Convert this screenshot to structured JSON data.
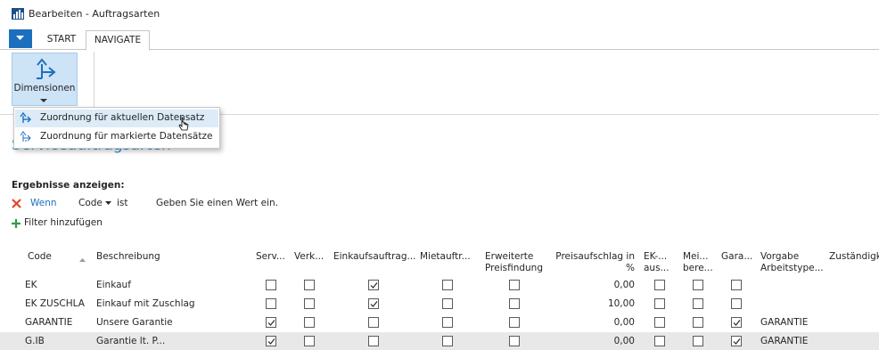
{
  "window": {
    "title": "Bearbeiten - Auftragsarten"
  },
  "ribbon": {
    "tabs": [
      {
        "label": "START"
      },
      {
        "label": "NAVIGATE"
      }
    ],
    "dimensionen_label": "Dimensionen",
    "menu": [
      {
        "label": "Zuordnung für aktuellen Datensatz"
      },
      {
        "label": "Zuordnung für markierte Datensätze"
      }
    ]
  },
  "page": {
    "title": "Serviceauftragsarten"
  },
  "filter": {
    "header": "Ergebnisse anzeigen:",
    "wenn": "Wenn",
    "field": "Code",
    "op": "ist",
    "value_placeholder": "Geben Sie einen Wert ein.",
    "add_label": "Filter hinzufügen"
  },
  "table": {
    "headers": {
      "code": "Code",
      "beschreibung": "Beschreibung",
      "serv": "Serv...",
      "verk": "Verk...",
      "einkauf": "Einkaufsauftrag...",
      "miet": "Mietauftr...",
      "erw1": "Erweiterte",
      "erw2": "Preisfindung",
      "preis1": "Preisaufschlag in",
      "preis2": "%",
      "ek1": "EK-...",
      "ek2": "aus...",
      "mei1": "Mei...",
      "mei2": "bere...",
      "gara": "Gara...",
      "vorgabe1": "Vorgabe",
      "vorgabe2": "Arbeitstype...",
      "zust": "Zuständigk"
    },
    "rows": [
      {
        "code": "EK",
        "beschreibung": "Einkauf",
        "serv": false,
        "verk": false,
        "einkauf": true,
        "miet": false,
        "erw": false,
        "preis": "0,00",
        "ek": false,
        "mei": false,
        "gara": false,
        "vorgabe": ""
      },
      {
        "code": "EK ZUSCHLA",
        "beschreibung": "Einkauf mit Zuschlag",
        "serv": false,
        "verk": false,
        "einkauf": true,
        "miet": false,
        "erw": false,
        "preis": "10,00",
        "ek": false,
        "mei": false,
        "gara": false,
        "vorgabe": ""
      },
      {
        "code": "GARANTIE",
        "beschreibung": "Unsere Garantie",
        "serv": true,
        "verk": false,
        "einkauf": false,
        "miet": false,
        "erw": false,
        "preis": "0,00",
        "ek": false,
        "mei": false,
        "gara": true,
        "vorgabe": "GARANTIE"
      },
      {
        "code": "G.IB",
        "beschreibung": "Garantie lt. P...",
        "serv": true,
        "verk": false,
        "einkauf": false,
        "miet": false,
        "erw": false,
        "preis": "0,00",
        "ek": false,
        "mei": false,
        "gara": true,
        "vorgabe": "GARANTIE"
      }
    ]
  },
  "colors": {
    "accent": "#1c6fbe",
    "title": "#2d8fd1",
    "selected_button": "#cde3f6",
    "remove": "#e0452b",
    "add": "#2e9d4b"
  }
}
